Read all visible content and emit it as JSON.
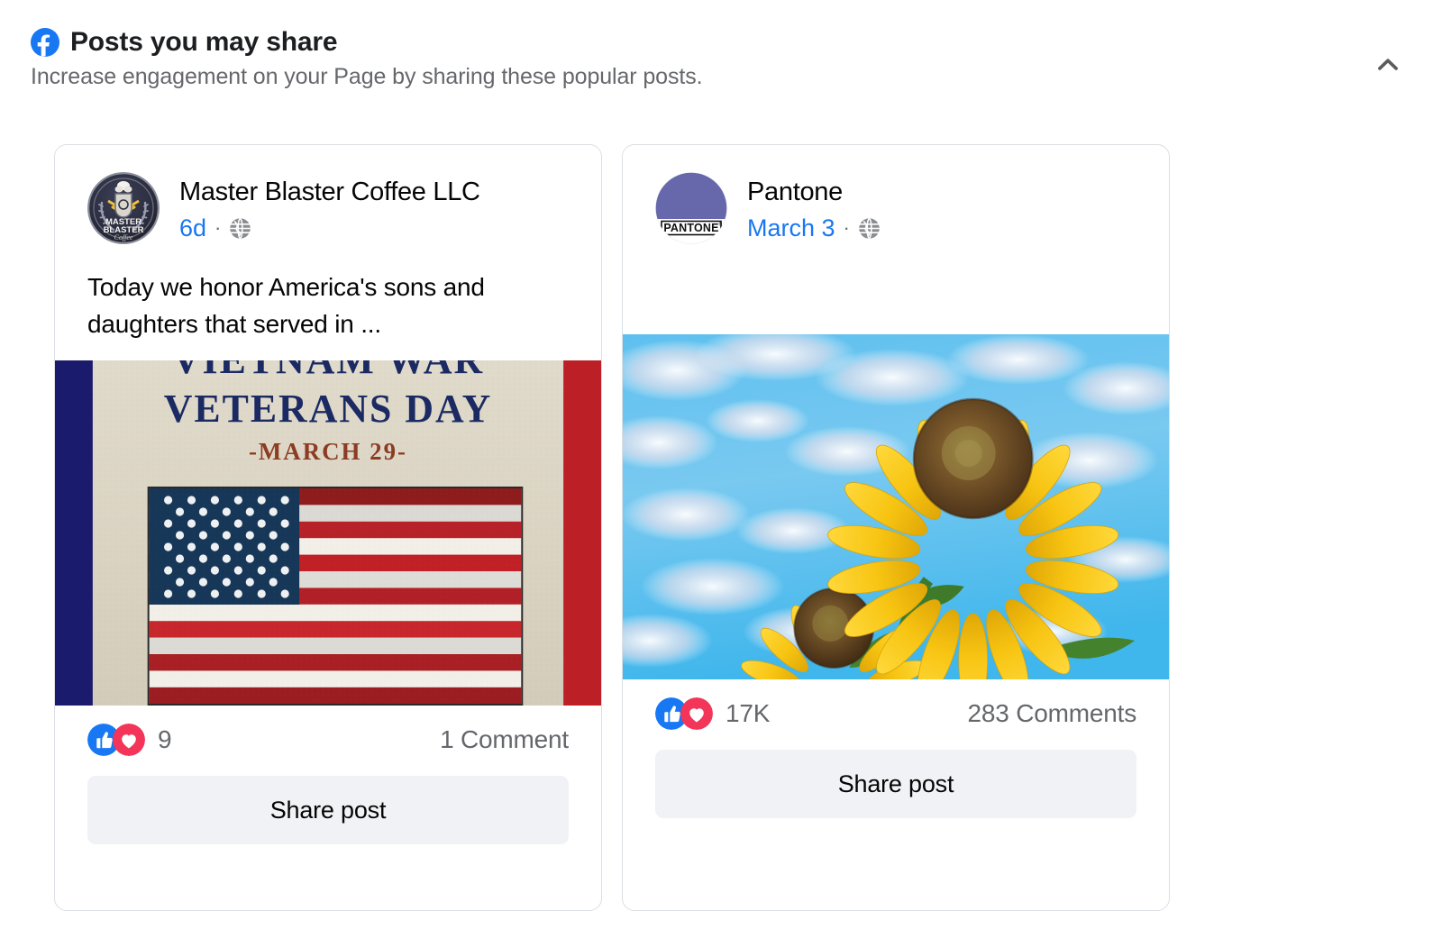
{
  "panel": {
    "title": "Posts you may share",
    "subtitle": "Increase engagement on your Page by sharing these popular posts.",
    "brand_icon": "facebook-logo-icon",
    "collapse_icon": "chevron-up-icon",
    "accent_color": "#1877f2",
    "muted_text_color": "#65676b"
  },
  "cards": [
    {
      "page_name": "Master Blaster Coffee LLC",
      "avatar_icon": "master-blaster-coffee-logo",
      "date": "6d",
      "separator": "·",
      "audience_icon": "globe-icon",
      "post_text": "Today we honor America's sons and daughters that served in ...",
      "media": {
        "type": "veterans-day-poster",
        "line1": "VIETNAM WAR",
        "line2": "VETERANS DAY",
        "line3": "-MARCH 29-",
        "band_left_color": "#1b1b6e",
        "band_right_color": "#bc2026",
        "paper_color": "#ddd6c6"
      },
      "reaction_icons": [
        "like-icon",
        "love-icon"
      ],
      "reaction_count": "9",
      "comment_count": "1 Comment",
      "share_label": "Share post"
    },
    {
      "page_name": "Pantone",
      "avatar_icon": "pantone-logo",
      "avatar_color": "#6768ab",
      "avatar_text": "PANTONE®",
      "date": "March 3",
      "separator": "·",
      "audience_icon": "globe-icon",
      "post_text": "",
      "media": {
        "type": "sunflowers-photo",
        "sky_color": "#4cb8ea",
        "petal_color": "#f5c21b",
        "center_color": "#7a5230"
      },
      "reaction_icons": [
        "like-icon",
        "love-icon"
      ],
      "reaction_count": "17K",
      "comment_count": "283 Comments",
      "share_label": "Share post"
    }
  ]
}
